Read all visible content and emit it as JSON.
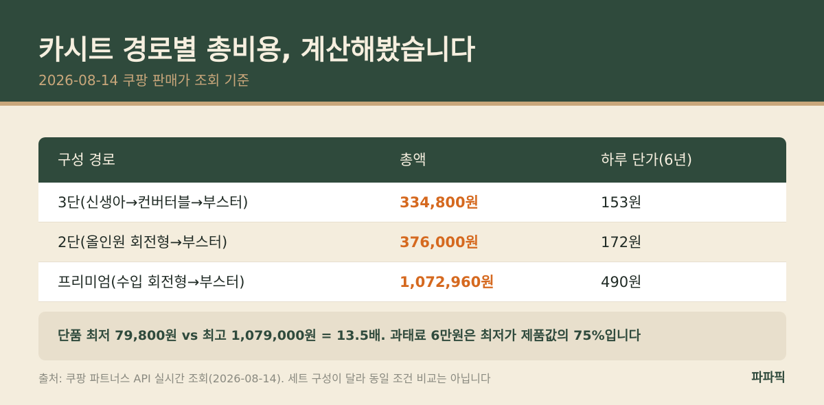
{
  "header": {
    "title": "카시트 경로별 총비용, 계산해봤습니다",
    "subtitle": "2026-08-14 쿠팡 판매가 조회 기준"
  },
  "table": {
    "columns": [
      "구성 경로",
      "총액",
      "하루 단가(6년)"
    ],
    "rows": [
      {
        "route": "3단(신생아→컨버터블→부스터)",
        "total": "334,800원",
        "daily": "153원"
      },
      {
        "route": "2단(올인원 회전형→부스터)",
        "total": "376,000원",
        "daily": "172원"
      },
      {
        "route": "프리미엄(수입 회전형→부스터)",
        "total": "1,072,960원",
        "daily": "490원"
      }
    ]
  },
  "note": "단품 최저 79,800원 vs 최고 1,079,000원 = 13.5배. 과태료 6만원은 최저가 제품값의 75%입니다",
  "footer": {
    "source": "출처: 쿠팡 파트너스 API 실시간 조회(2026-08-14). 세트 구성이 달라 동일 조건 비교는 아닙니다",
    "brand": "파파픽"
  },
  "colors": {
    "header_bg": "#2f4a3c",
    "accent_gold": "#c9a77b",
    "page_bg": "#f4eddd",
    "total_orange": "#d5691f"
  }
}
